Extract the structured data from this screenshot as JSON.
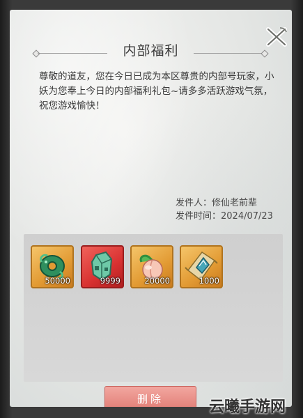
{
  "dialog": {
    "title": "内部福利",
    "message": "尊敬的道友，您在今日已成为本区尊贵的内部号玩家，小妖为您奉上今日的内部福利礼包~请多多活跃游戏气氛，祝您游戏愉快！",
    "sender_line": "发件人：修仙老前辈",
    "time_line": "发件时间：2024/07/23"
  },
  "rewards": [
    {
      "icon": "jade-dragon-icon",
      "count": "50000"
    },
    {
      "icon": "jade-stone-icon",
      "count": "9999"
    },
    {
      "icon": "peach-icon",
      "count": "20000"
    },
    {
      "icon": "talisman-scroll-icon",
      "count": "1000"
    }
  ],
  "actions": {
    "delete_label": "删除"
  },
  "watermark": "云曦手游网",
  "colors": {
    "panel_bg": "#e4e6e4",
    "item_gold": "#e29a33",
    "item_red": "#d83131",
    "delete_button": "#e07a72"
  }
}
